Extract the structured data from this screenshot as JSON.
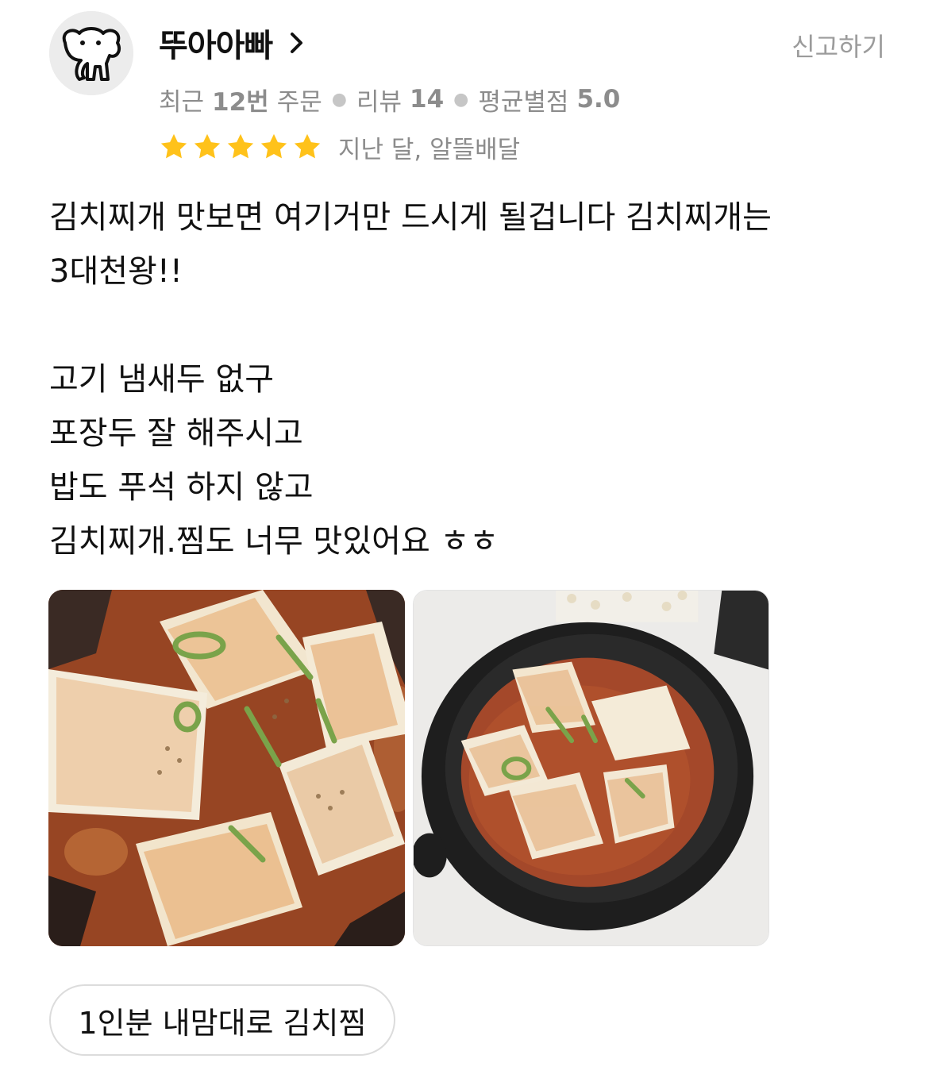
{
  "user": {
    "name": "뚜아아빠"
  },
  "report_label": "신고하기",
  "meta": {
    "recent_prefix": "최근",
    "orders": "12번",
    "orders_suffix": "주문",
    "reviews_label": "리뷰",
    "reviews_count": "14",
    "avg_label": "평균별점",
    "avg_value": "5.0"
  },
  "review": {
    "rating": 5,
    "date_delivery": "지난 달, 알뜰배달",
    "lines": [
      "김치찌개 맛보면 여기거만 드시게 될겁니다 김치찌개는",
      "3대천왕!!",
      "",
      "고기 냄새두 없구",
      "포장두 잘 해주시고",
      "밥도 푸석 하지 않고",
      "김치찌개.찜도 너무 맛있어요 ㅎㅎ"
    ]
  },
  "menu_chip": "1인분 내맘대로 김치찜",
  "colors": {
    "star": "#FFC21A",
    "meta_text": "#8C8C8C",
    "chip_border": "#DCDCDC"
  },
  "icons": {
    "avatar": "elephant-icon",
    "chevron": "chevron-right-icon",
    "star": "star-icon"
  }
}
